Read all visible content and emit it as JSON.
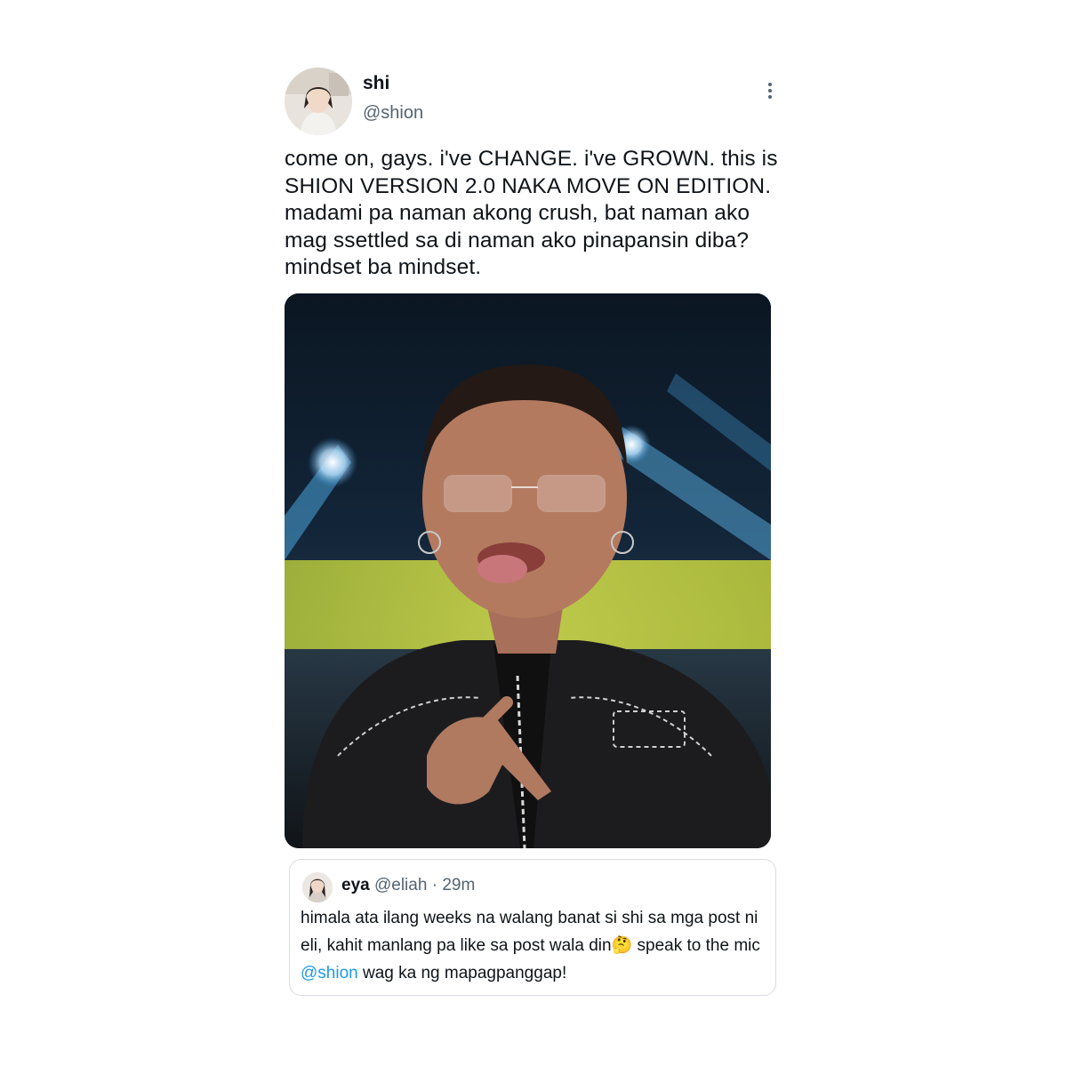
{
  "tweet": {
    "display_name": "shi",
    "handle": "@shion",
    "text": "come on, gays. i've CHANGE. i've GROWN. this is SHION VERSION 2.0 NAKA MOVE ON EDITION. madami pa naman akong crush, bat naman ako mag ssettled sa di naman ako pinapansin diba? mindset ba mindset.",
    "more_icon": "more-vertical-icon"
  },
  "quoted_tweet": {
    "display_name": "eya",
    "handle": "@eliah",
    "separator": "·",
    "time": "29m",
    "text_before": "himala ata ilang weeks na walang banat si shi sa mga post ni eli, kahit manlang pa like sa post wala din🤔 speak to the mic ",
    "mention": "@shion",
    "text_after": " wag ka ng mapagpanggap!"
  },
  "colors": {
    "text_primary": "#0f1419",
    "text_secondary": "#536471",
    "link": "#1d9bf0",
    "border": "#d9dde1"
  }
}
